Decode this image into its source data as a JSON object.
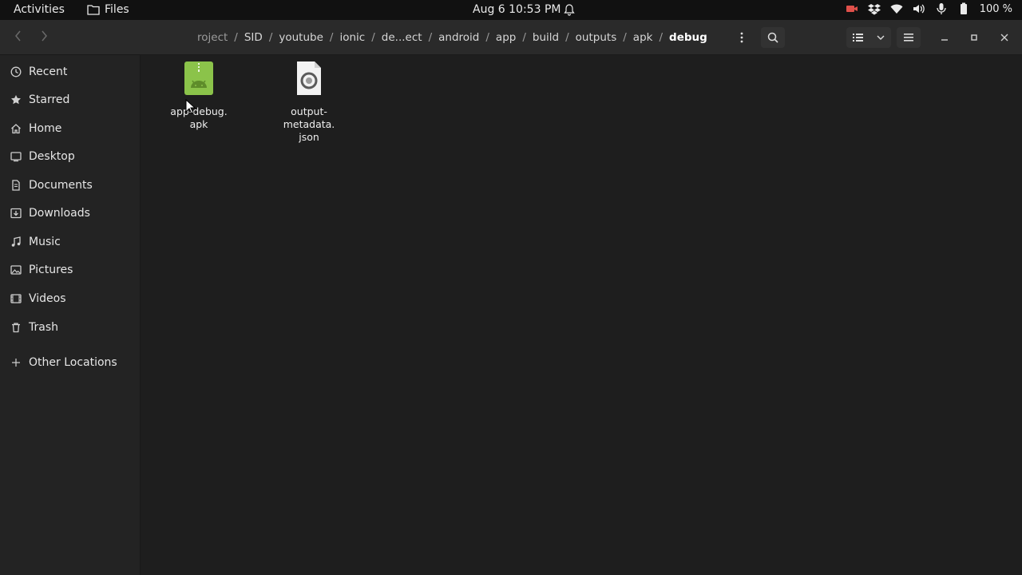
{
  "topbar": {
    "activities": "Activities",
    "app_name": "Files",
    "clock": "Aug 6  10:53 PM",
    "battery": "100 %"
  },
  "header": {
    "path": [
      {
        "label": "roject",
        "faded": true
      },
      {
        "label": "SID"
      },
      {
        "label": "youtube"
      },
      {
        "label": "ionic"
      },
      {
        "label": "de...ect"
      },
      {
        "label": "android"
      },
      {
        "label": "app"
      },
      {
        "label": "build"
      },
      {
        "label": "outputs"
      },
      {
        "label": "apk"
      },
      {
        "label": "debug",
        "current": true
      }
    ],
    "separator": "/"
  },
  "sidebar": {
    "items": [
      {
        "label": "Recent",
        "icon": "clock-icon"
      },
      {
        "label": "Starred",
        "icon": "star-icon"
      },
      {
        "label": "Home",
        "icon": "home-icon"
      },
      {
        "label": "Desktop",
        "icon": "desktop-icon"
      },
      {
        "label": "Documents",
        "icon": "document-icon"
      },
      {
        "label": "Downloads",
        "icon": "download-icon"
      },
      {
        "label": "Music",
        "icon": "music-icon"
      },
      {
        "label": "Pictures",
        "icon": "picture-icon"
      },
      {
        "label": "Videos",
        "icon": "video-icon"
      },
      {
        "label": "Trash",
        "icon": "trash-icon"
      },
      {
        "label": "Other Locations",
        "icon": "plus-icon"
      }
    ]
  },
  "files": [
    {
      "name_lines": [
        "app-debug.",
        "apk"
      ],
      "icon": "apk-file-icon",
      "color": "#8bc34a"
    },
    {
      "name_lines": [
        "output-",
        "metadata.",
        "json"
      ],
      "icon": "json-file-icon",
      "color": "#f2f2f2"
    }
  ]
}
